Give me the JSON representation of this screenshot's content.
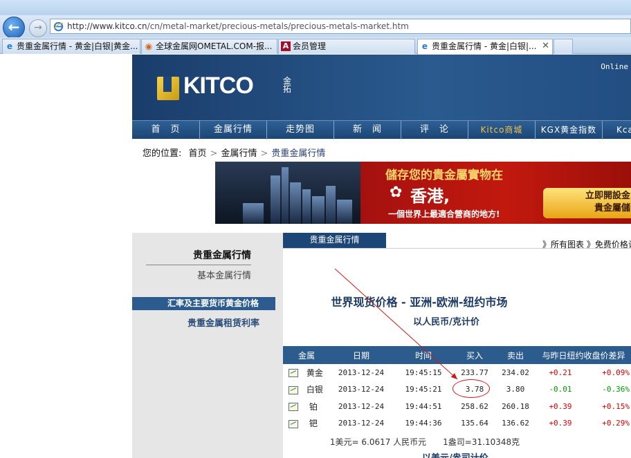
{
  "address_bar": {
    "url_prefix": "http://www.kitco.cn",
    "url_path": "/cn/metal-market/precious-metals/precious-metals-market.htm"
  },
  "tabs": [
    {
      "label": "贵重金属行情 - 黄金|白银|黄金...",
      "icon": "ie-icon",
      "active": false
    },
    {
      "label": "全球金属网OMETAL.COM-报...",
      "icon": "globe-icon",
      "active": false
    },
    {
      "label": "会员管理",
      "icon": "a-icon",
      "active": false
    },
    {
      "label": "贵重金属行情 - 黄金|白银|...",
      "icon": "ie-icon",
      "active": true
    }
  ],
  "header": {
    "logo_text": "KITCO",
    "logo_cn": "金拓",
    "online": "Online"
  },
  "menu": [
    "首　页",
    "金属行情",
    "走势图",
    "新　闻",
    "评　论",
    "Kitco商城",
    "KGX黄金指数",
    "Kcas"
  ],
  "breadcrumb": {
    "prefix": "您的位置:",
    "items": [
      "首页",
      "金属行情",
      "贵重金属行情"
    ]
  },
  "ad": {
    "line1": "儲存您的貴金屬實物在",
    "line2": "香港,",
    "line3": "一個世界上最適合營商的地方!",
    "button_line1": "立即開設金",
    "button_line2": "貴金屬儲"
  },
  "sidebar": {
    "item1": "贵重金属行情",
    "item2": "基本金属行情",
    "item3": "汇率及主要货币黄金价格",
    "item4": "贵重金属租赁利率"
  },
  "main": {
    "tab": "贵重金属行情",
    "links": "》所有图表 》免费价格计",
    "title": "世界现货价格 - 亚洲-欧洲-纽约市场",
    "subtitle": "以人民币/克计价",
    "note": "1美元= 6.0617 人民币元　　1盎司=31.10348克",
    "next_title": "以美元/盎司计价"
  },
  "table": {
    "headers": [
      "金属",
      "日期",
      "时间",
      "买入",
      "卖出",
      "与昨日纽约收盘价差异"
    ],
    "rows": [
      {
        "metal": "黄金",
        "date": "2013-12-24",
        "time": "19:45:15",
        "bid": "233.77",
        "ask": "234.02",
        "chg": "+0.21",
        "pct": "+0.09%"
      },
      {
        "metal": "白银",
        "date": "2013-12-24",
        "time": "19:45:21",
        "bid": "3.78",
        "ask": "3.80",
        "chg": "-0.01",
        "pct": "-0.36%"
      },
      {
        "metal": "铂",
        "date": "2013-12-24",
        "time": "19:44:51",
        "bid": "258.62",
        "ask": "260.18",
        "chg": "+0.39",
        "pct": "+0.15%"
      },
      {
        "metal": "钯",
        "date": "2013-12-24",
        "time": "19:44:36",
        "bid": "135.64",
        "ask": "136.62",
        "chg": "+0.39",
        "pct": "+0.29%"
      }
    ]
  },
  "colors": {
    "header_blue": "#1c4676",
    "table_head": "#2c5b8e",
    "positive": "#dd0000",
    "negative": "#009900",
    "annotation": "#d01a1a"
  }
}
